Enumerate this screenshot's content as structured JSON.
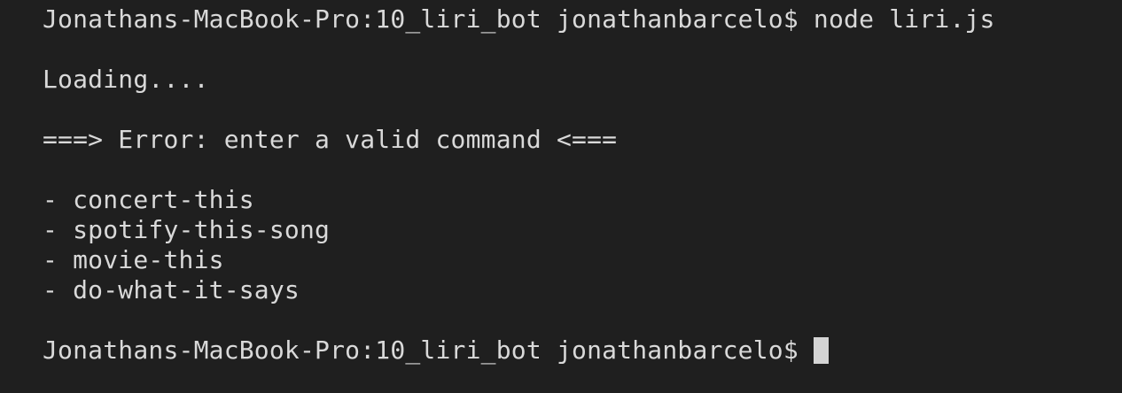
{
  "terminal": {
    "prompt_1": "Jonathans-MacBook-Pro:10_liri_bot jonathanbarcelo$ node liri.js",
    "loading": "Loading....",
    "error": "===> Error: enter a valid command <===",
    "commands": [
      "- concert-this",
      "- spotify-this-song",
      "- movie-this",
      "- do-what-it-says"
    ],
    "prompt_2": "Jonathans-MacBook-Pro:10_liri_bot jonathanbarcelo$ "
  },
  "colors": {
    "background": "#1f1f1f",
    "text": "#d9d9d9",
    "cursor": "#d4d4d4"
  }
}
